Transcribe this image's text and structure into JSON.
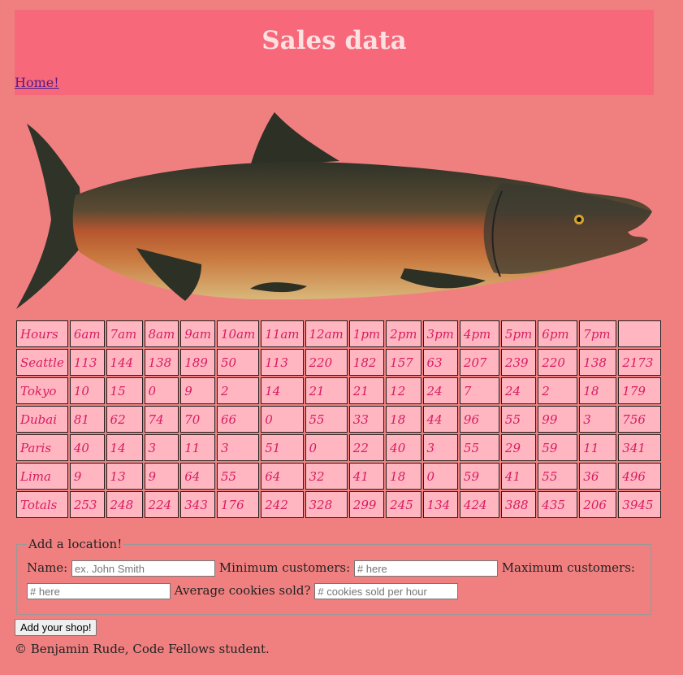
{
  "header": {
    "title": "Sales data",
    "home_link": "Home!"
  },
  "table": {
    "hours": [
      "Hours",
      "6am",
      "7am",
      "8am",
      "9am",
      "10am",
      "11am",
      "12am",
      "1pm",
      "2pm",
      "3pm",
      "4pm",
      "5pm",
      "6pm",
      "7pm",
      ""
    ],
    "rows": [
      [
        "Seattle",
        "113",
        "144",
        "138",
        "189",
        "50",
        "113",
        "220",
        "182",
        "157",
        "63",
        "207",
        "239",
        "220",
        "138",
        "2173"
      ],
      [
        "Tokyo",
        "10",
        "15",
        "0",
        "9",
        "2",
        "14",
        "21",
        "21",
        "12",
        "24",
        "7",
        "24",
        "2",
        "18",
        "179"
      ],
      [
        "Dubai",
        "81",
        "62",
        "74",
        "70",
        "66",
        "0",
        "55",
        "33",
        "18",
        "44",
        "96",
        "55",
        "99",
        "3",
        "756"
      ],
      [
        "Paris",
        "40",
        "14",
        "3",
        "11",
        "3",
        "51",
        "0",
        "22",
        "40",
        "3",
        "55",
        "29",
        "59",
        "11",
        "341"
      ],
      [
        "Lima",
        "9",
        "13",
        "9",
        "64",
        "55",
        "64",
        "32",
        "41",
        "18",
        "0",
        "59",
        "41",
        "55",
        "36",
        "496"
      ],
      [
        "Totals",
        "253",
        "248",
        "224",
        "343",
        "176",
        "242",
        "328",
        "299",
        "245",
        "134",
        "424",
        "388",
        "435",
        "206",
        "3945"
      ]
    ]
  },
  "form": {
    "legend": "Add a location!",
    "name_label": "Name:",
    "name_placeholder": "ex. John Smith",
    "min_label": "Minimum customers:",
    "min_placeholder": "# here",
    "max_label": "Maximum customers:",
    "max_placeholder": "# here",
    "avg_label": "Average cookies sold?",
    "avg_placeholder": "# cookies sold per hour",
    "submit_label": "Add your shop!"
  },
  "footer": {
    "text": "© Benjamin Rude, Code Fellows student."
  },
  "colors": {
    "page_bg": "#f08080",
    "header_bg": "#f7687a",
    "cell_bg": "#ffb6c1",
    "cell_text": "#d81b60"
  }
}
